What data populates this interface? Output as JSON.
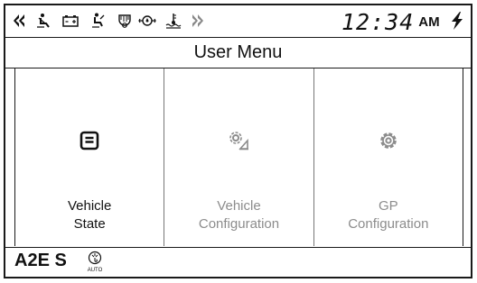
{
  "status_bar": {
    "icons": [
      {
        "name": "left-turn-signal-icon"
      },
      {
        "name": "seat-belt-icon"
      },
      {
        "name": "battery-icon"
      },
      {
        "name": "operator-presence-icon"
      },
      {
        "name": "air-filter-icon"
      },
      {
        "name": "oil-pressure-icon"
      },
      {
        "name": "coolant-temperature-icon"
      },
      {
        "name": "right-turn-signal-icon"
      }
    ],
    "time": "12:34",
    "ampm": "AM",
    "charging_icon": "lightning-icon"
  },
  "title": "User Menu",
  "menu": {
    "items": [
      {
        "line1": "Vehicle",
        "line2": "State",
        "icon": "document-icon",
        "enabled": true
      },
      {
        "line1": "Vehicle",
        "line2": "Configuration",
        "icon": "vehicle-settings-icon",
        "enabled": false
      },
      {
        "line1": "GP",
        "line2": "Configuration",
        "icon": "gear-icon",
        "enabled": false
      }
    ]
  },
  "footer": {
    "mode": "A2E S",
    "auto_label": "AUTO",
    "auto_icon": "auto-idle-icon"
  },
  "colors": {
    "enabled": "#111111",
    "disabled": "#8c8c8c",
    "border": "#1a1a1a"
  }
}
